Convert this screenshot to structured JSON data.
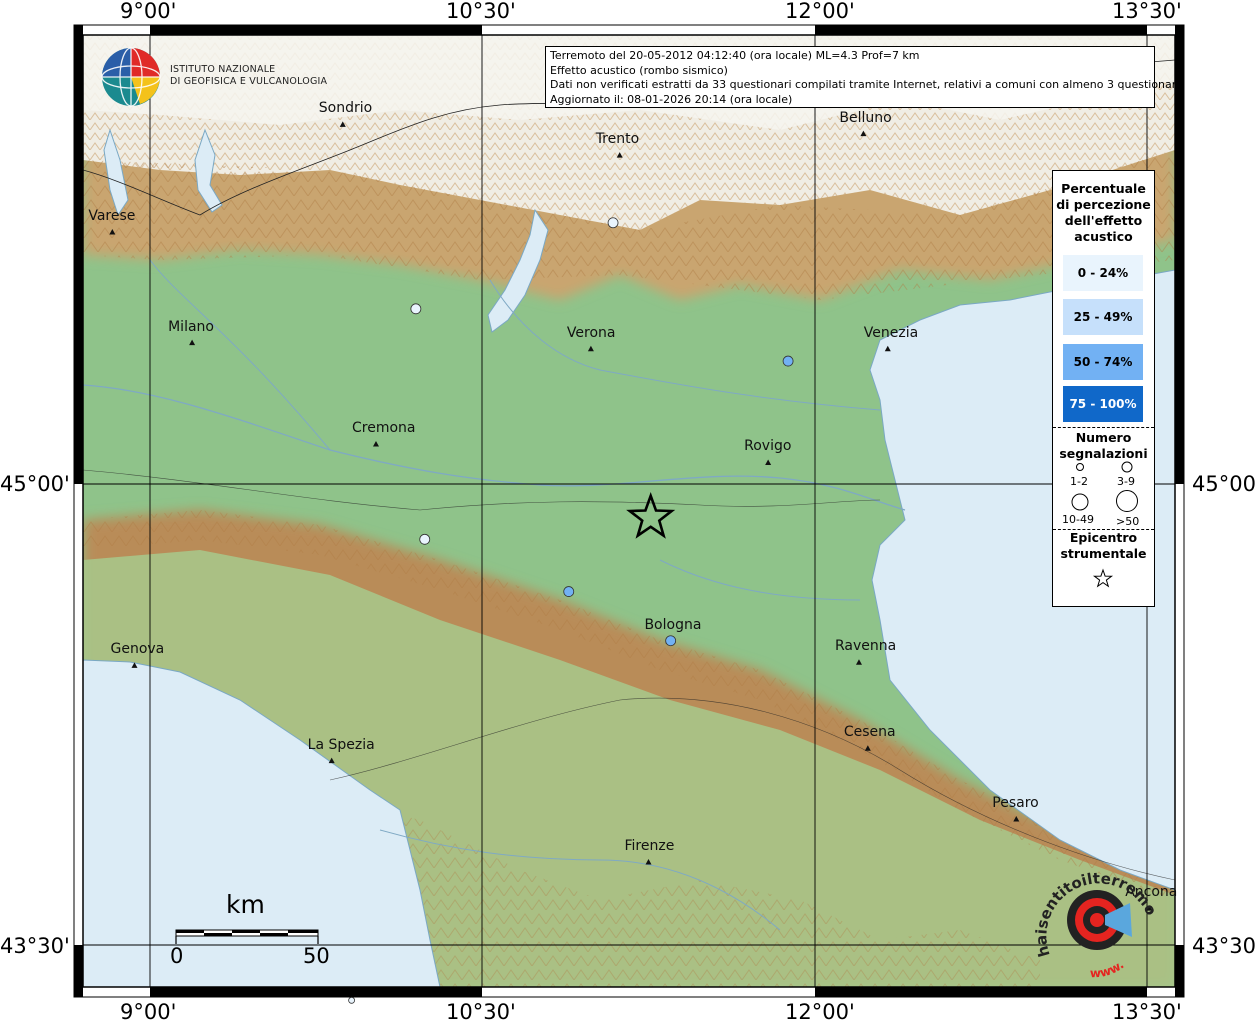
{
  "map": {
    "ticks_top": [
      "9°00'",
      "10°30'",
      "12°00'",
      "13°30'"
    ],
    "ticks_bottom": [
      "9°00'",
      "10°30'",
      "12°00'",
      "13°30'"
    ],
    "ticks_left": [
      "45°00'",
      "43°30'"
    ],
    "ticks_right": [
      "45°00'",
      "43°30'"
    ],
    "colors": {
      "sea": "#dcecf6",
      "plain": "#8fc38a",
      "mountain": "#c79b61",
      "snow": "#f4f4ef",
      "grid": "#000000",
      "pct_0_24": "#e9f4fd",
      "pct_25_49": "#c6e0fb",
      "pct_50_74": "#72b1f3",
      "pct_75_100": "#1068c9"
    },
    "cities": [
      {
        "name": "Sondrio",
        "lon": 9.87,
        "lat": 46.17
      },
      {
        "name": "Trento",
        "lon": 11.12,
        "lat": 46.07
      },
      {
        "name": "Belluno",
        "lon": 12.22,
        "lat": 46.14
      },
      {
        "name": "Varese",
        "lon": 8.83,
        "lat": 45.82
      },
      {
        "name": "Milano",
        "lon": 9.19,
        "lat": 45.46
      },
      {
        "name": "Verona",
        "lon": 10.99,
        "lat": 45.44
      },
      {
        "name": "Venezia",
        "lon": 12.33,
        "lat": 45.44
      },
      {
        "name": "Cremona",
        "lon": 10.02,
        "lat": 45.13
      },
      {
        "name": "Rovigo",
        "lon": 11.79,
        "lat": 45.07
      },
      {
        "name": "Bologna",
        "lon": 11.34,
        "lat": 44.49
      },
      {
        "name": "Genova",
        "lon": 8.93,
        "lat": 44.41
      },
      {
        "name": "Ravenna",
        "lon": 12.2,
        "lat": 44.42
      },
      {
        "name": "La Spezia",
        "lon": 9.82,
        "lat": 44.1
      },
      {
        "name": "Cesena",
        "lon": 12.24,
        "lat": 44.14
      },
      {
        "name": "Pesaro",
        "lon": 12.91,
        "lat": 43.91
      },
      {
        "name": "Firenze",
        "lon": 11.25,
        "lat": 43.77
      },
      {
        "name": "Ancona",
        "lon": 13.51,
        "lat": 43.62
      }
    ],
    "reports": [
      {
        "lon": 11.09,
        "lat": 45.85,
        "class": "0-24"
      },
      {
        "lon": 10.2,
        "lat": 45.57,
        "class": "0-24"
      },
      {
        "lon": 11.88,
        "lat": 45.4,
        "class": "50-74"
      },
      {
        "lon": 10.24,
        "lat": 44.82,
        "class": "0-24"
      },
      {
        "lon": 10.89,
        "lat": 44.65,
        "class": "50-74"
      },
      {
        "lon": 11.35,
        "lat": 44.49,
        "class": "50-74"
      },
      {
        "lon": 9.91,
        "lat": 43.32,
        "class": "small"
      }
    ],
    "epicenter": {
      "lon": 11.26,
      "lat": 44.89
    }
  },
  "ingv": {
    "line1": "ISTITUTO NAZIONALE",
    "line2": "DI GEOFISICA E VULCANOLOGIA"
  },
  "info": {
    "line1": "Terremoto del 20-05-2012 04:12:40 (ora locale) ML=4.3 Prof=7 km",
    "line2": "Effetto acustico (rombo sismico)",
    "line3": "Dati non verificati estratti da 33 questionari compilati tramite Internet, relativi a comuni con almeno 3 questionari.",
    "line4": "Aggiornato il: 08-01-2026 20:14 (ora locale)"
  },
  "legend": {
    "title": [
      "Percentuale",
      "di percezione",
      "dell'effetto",
      "acustico"
    ],
    "classes": [
      "0 - 24%",
      "25 - 49%",
      "50 - 74%",
      "75 - 100%"
    ],
    "count_title": [
      "Numero",
      "segnalazioni"
    ],
    "sizes": [
      "1-2",
      "3-9",
      "10-49",
      ">50"
    ],
    "epi_title": [
      "Epicentro",
      "strumentale"
    ]
  },
  "scale": {
    "unit": "km",
    "start": "0",
    "end": "50"
  },
  "hsit": {
    "brand": "haisentitoilterremoto.it",
    "url_prefix": "www."
  }
}
